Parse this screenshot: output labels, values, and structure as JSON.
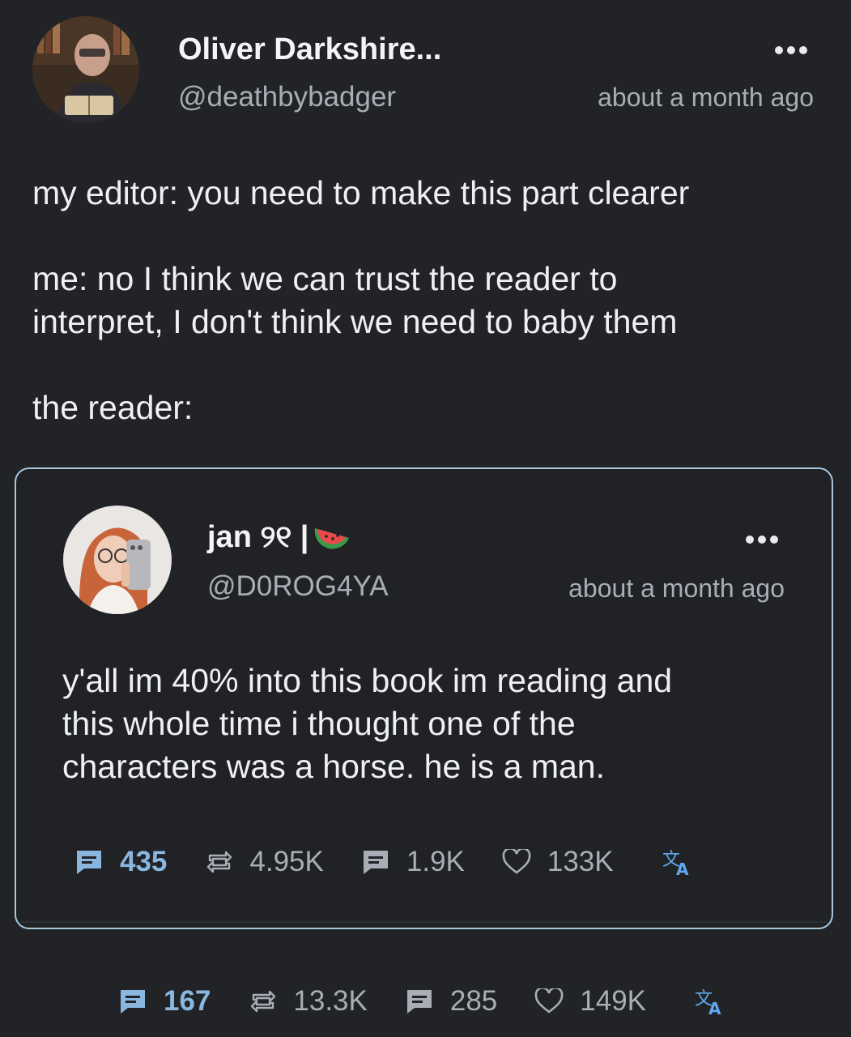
{
  "post": {
    "author": {
      "display_name": "Oliver Darkshire...",
      "handle": "@deathbybadger",
      "avatar_icon": "person-reading-book-avatar"
    },
    "timestamp": "about a month ago",
    "more_icon": "more-horizontal-icon",
    "text": "my editor: you need to make this part clearer\n\nme: no I think we can trust the reader to\ninterpret, I don't think we need to baby them\n\nthe reader:",
    "stats": {
      "quotes": "167",
      "reposts": "13.3K",
      "replies": "285",
      "likes": "149K"
    }
  },
  "quoted_post": {
    "author": {
      "display_name": "jan ୨୧ |",
      "name_emoji_icon": "watermelon-emoji",
      "handle": "@D0ROG4YA",
      "avatar_icon": "selfie-avatar"
    },
    "timestamp": "about a month ago",
    "more_icon": "more-horizontal-icon",
    "text": "y'all im 40% into this book im reading and\nthis whole time i thought one of the\ncharacters was a horse. he is a man.",
    "stats": {
      "quotes": "435",
      "reposts": "4.95K",
      "replies": "1.9K",
      "likes": "133K"
    }
  },
  "icons": {
    "quote": "quote-bubble-icon",
    "repost": "repost-icon",
    "reply": "reply-bubble-icon",
    "like": "heart-icon",
    "translate": "translate-icon"
  },
  "colors": {
    "background": "#222326",
    "card_border": "#a8c8e0",
    "accent_stat": "#8ab7e0",
    "translate": "#5fa8ef",
    "muted_text": "#a9adb5"
  }
}
